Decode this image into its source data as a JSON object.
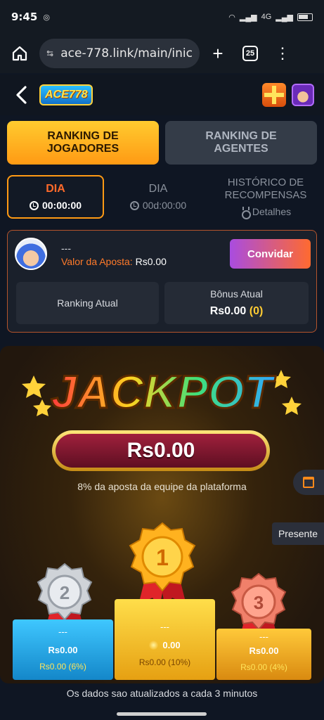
{
  "status_bar": {
    "time": "9:45",
    "network": "4G"
  },
  "browser": {
    "url": "ace-778.link/main/inic",
    "tab_count": "25"
  },
  "app": {
    "logo_text": "ACE778"
  },
  "ranking_tabs": [
    {
      "label": "RANKING DE JOGADORES",
      "active": true
    },
    {
      "label": "RANKING DE AGENTES",
      "active": false
    }
  ],
  "periods": [
    {
      "title": "DIA",
      "sub": "00:00:00",
      "active": true
    },
    {
      "title": "DIA",
      "sub": "00d:00:00",
      "active": false
    },
    {
      "title": "HISTÓRICO DE RECOMPENSAS",
      "sub": "Detalhes",
      "active": false
    }
  ],
  "user": {
    "name": "---",
    "bet_label": "Valor da Aposta:",
    "bet_value": "Rs0.00",
    "invite_label": "Convidar",
    "ranking_label": "Ranking Atual",
    "bonus_label": "Bônus Atual",
    "bonus_value": "Rs0.00",
    "bonus_paren": "(0)"
  },
  "jackpot": {
    "title": "JACKPOT",
    "amount": "Rs0.00",
    "note": "8% da aposta da equipe da plataforma",
    "present_label": "Presente"
  },
  "podium": {
    "first": {
      "rank": "1",
      "name": "---",
      "amount": "0.00",
      "share": "Rs0.00 (10%)"
    },
    "second": {
      "rank": "2",
      "name": "---",
      "amount": "Rs0.00",
      "share": "Rs0.00 (6%)"
    },
    "third": {
      "rank": "3",
      "name": "---",
      "amount": "Rs0.00",
      "share": "Rs0.00 (4%)"
    }
  },
  "footer_note": "Os dados sao atualizados a cada 3 minutos",
  "colors": {
    "accent": "#ff9a14",
    "panel": "#1a202b",
    "invite_start": "#a94ce0",
    "invite_end": "#ff6a2f"
  }
}
